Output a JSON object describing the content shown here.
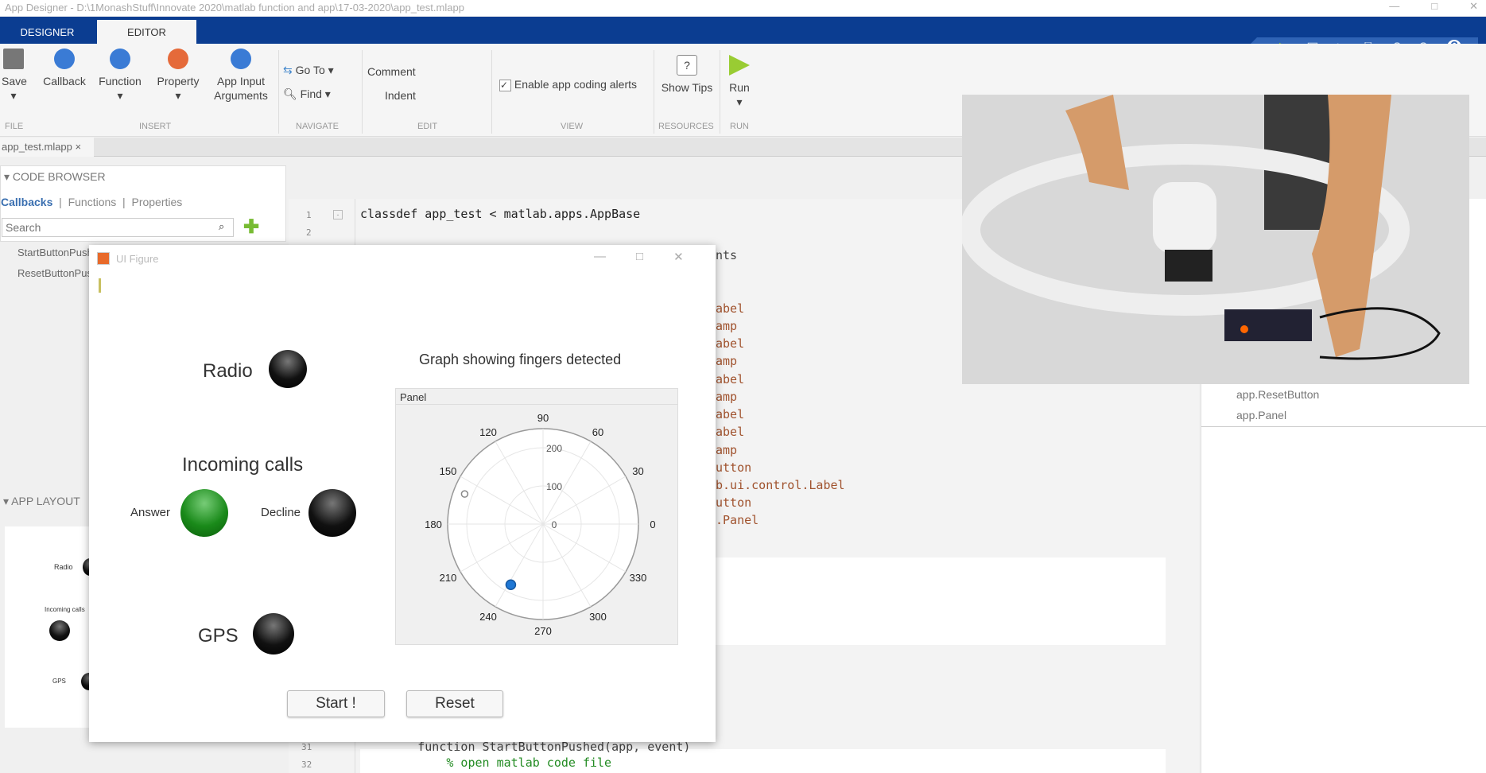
{
  "titlebar": {
    "title": "App Designer - D:\\1MonashStuff\\Innovate 2020\\matlab function and app\\17-03-2020\\app_test.mlapp"
  },
  "tabs": {
    "designer": "DESIGNER",
    "editor": "EDITOR"
  },
  "ribbon": {
    "save": "Save",
    "callback": "Callback",
    "function": "Function",
    "property": "Property",
    "app_input": "App Input",
    "arguments": "Arguments",
    "goto": "Go To",
    "find": "Find",
    "comment": "Comment",
    "indent": "Indent",
    "enable_alerts": "Enable app coding alerts",
    "enable_alerts_checked": true,
    "show_tips": "Show Tips",
    "run": "Run",
    "groups": {
      "file": "FILE",
      "insert": "INSERT",
      "navigate": "NAVIGATE",
      "edit": "EDIT",
      "view": "VIEW",
      "resources": "RESOURCES",
      "run": "RUN"
    }
  },
  "file_tab": "app_test.mlapp",
  "code_browser": {
    "title": "CODE BROWSER",
    "tabs": [
      "Callbacks",
      "Functions",
      "Properties"
    ],
    "search_placeholder": "Search",
    "items": [
      "StartButtonPushed",
      "ResetButtonPushed"
    ]
  },
  "app_layout": {
    "title": "APP LAYOUT",
    "thumb": {
      "radio": "Radio",
      "incoming": "Incoming calls",
      "gps": "GPS"
    }
  },
  "editor": {
    "line1_num": "1",
    "line2_num": "2",
    "line1": "classdef app_test < matlab.apps.AppBase",
    "partial_lines": [
      "nts",
      "abel",
      "amp",
      "abel",
      "amp",
      "abel",
      "amp",
      "abel",
      "abel",
      "amp",
      "utton",
      "b.ui.control.Label",
      "utton",
      ".Panel"
    ],
    "line31_num": "31",
    "line31": "        function StartButtonPushed(app, event)",
    "line32_num": "32",
    "line32": "            % open matlab code file"
  },
  "component_list": [
    "app.ResetButton",
    "app.Panel"
  ],
  "ui_figure": {
    "title": "UI Figure",
    "radio_label": "Radio",
    "incoming_label": "Incoming calls",
    "answer_label": "Answer",
    "decline_label": "Decline",
    "gps_label": "GPS",
    "lamps": {
      "radio": "off",
      "answer": "on",
      "decline": "off",
      "gps": "off"
    },
    "graph_title": "Graph showing fingers detected",
    "panel_title": "Panel",
    "start_button": "Start !",
    "reset_button": "Reset"
  },
  "chart_data": {
    "type": "scatter",
    "coordinate_system": "polar",
    "theta_ticks": [
      "0",
      "30",
      "60",
      "90",
      "120",
      "150",
      "180",
      "210",
      "240",
      "270",
      "300",
      "330"
    ],
    "r_ticks": [
      "0",
      "100",
      "200"
    ],
    "rlim": [
      0,
      250
    ],
    "points": [
      {
        "theta": 159,
        "r": 220,
        "style": "hollow-gray"
      },
      {
        "theta": 242,
        "r": 180,
        "style": "filled-blue"
      }
    ],
    "colors": {
      "filled": "#1f77d4",
      "hollow": "#888888"
    }
  },
  "colors": {
    "accent": "#0b3d91",
    "lamp_on": "#1a8a1a"
  }
}
